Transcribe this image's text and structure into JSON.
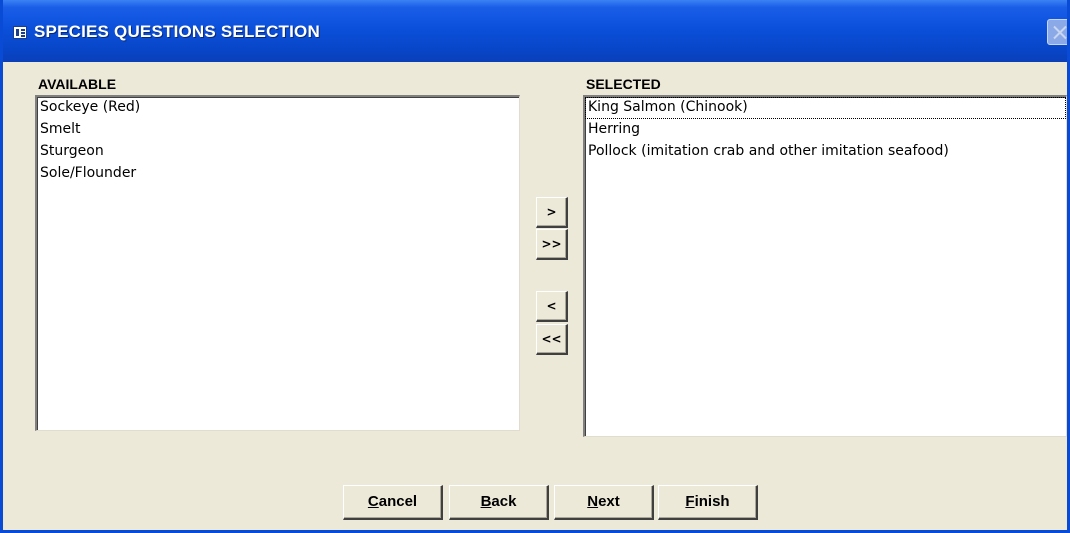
{
  "window": {
    "title": "SPECIES QUESTIONS SELECTION",
    "icon": "form-icon",
    "close_icon": "close-icon"
  },
  "available": {
    "heading": "AVAILABLE",
    "items": [
      "Sockeye  (Red)",
      "Smelt",
      "Sturgeon",
      "Sole/Flounder"
    ]
  },
  "selected": {
    "heading": "SELECTED",
    "items": [
      "King Salmon  (Chinook)",
      "Herring",
      "Pollock  (imitation crab and other imitation seafood)"
    ],
    "focused_index": 0
  },
  "move_buttons": {
    "add_one": ">",
    "add_all": ">>",
    "remove_one": "<",
    "remove_all": "<<"
  },
  "footer": {
    "cancel": {
      "first": "C",
      "rest": "ancel"
    },
    "back": {
      "first": "B",
      "rest": "ack"
    },
    "next": {
      "first": "N",
      "rest": "ext"
    },
    "finish": {
      "first": "F",
      "rest": "inish"
    }
  },
  "colors": {
    "titlebar": "#0a50db",
    "face": "#ece9d8",
    "frame": "#0a4bd6"
  }
}
